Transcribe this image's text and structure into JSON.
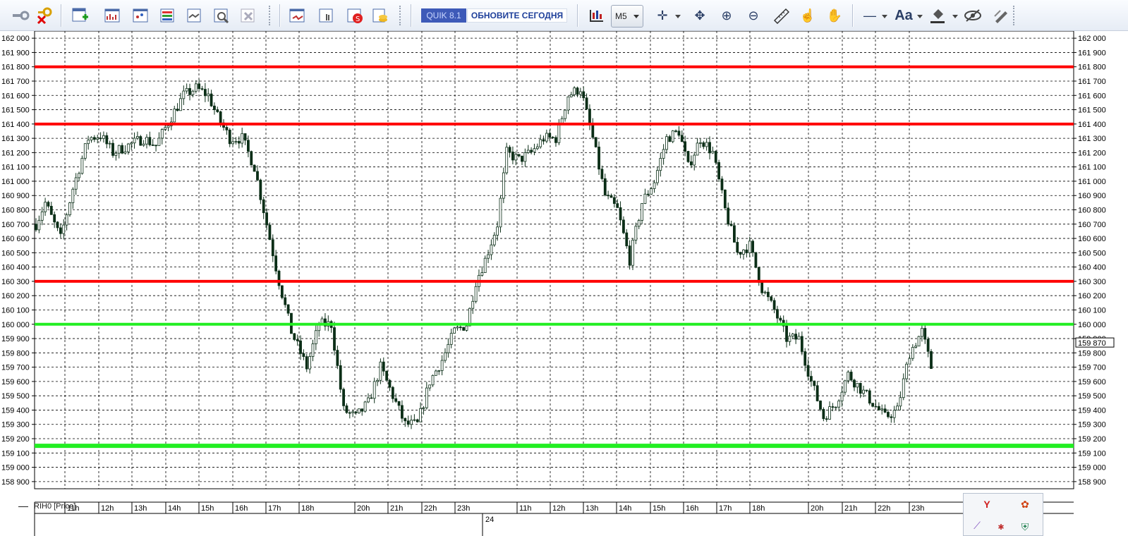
{
  "toolbar": {
    "quik_version": "QUIK 8.1",
    "update_label": "ОБНОВИТЕ СЕГОДНЯ",
    "timeframe": "M5",
    "font_button": "Aa"
  },
  "chart": {
    "instrument_label": "RIH0 [Price]",
    "last_price": "159 870",
    "price_ticks": [
      "162 000",
      "161 900",
      "161 800",
      "161 700",
      "161 600",
      "161 500",
      "161 400",
      "161 300",
      "161 200",
      "161 100",
      "161 000",
      "160 900",
      "160 800",
      "160 700",
      "160 600",
      "160 500",
      "160 400",
      "160 300",
      "160 200",
      "160 100",
      "160 000",
      "159 900",
      "159 800",
      "159 700",
      "159 600",
      "159 500",
      "159 400",
      "159 300",
      "159 200",
      "159 100",
      "159 000",
      "158 900"
    ],
    "time_ticks": [
      "11h",
      "12h",
      "13h",
      "14h",
      "15h",
      "16h",
      "17h",
      "18h",
      "20h",
      "21h",
      "22h",
      "23h",
      "11h",
      "12h",
      "13h",
      "14h",
      "15h",
      "16h",
      "17h",
      "18h",
      "20h",
      "21h",
      "22h",
      "23h"
    ],
    "date_label": "24",
    "colors": {
      "resistance": "#ff0000",
      "support": "#22ee22",
      "candle": "#0b2e17",
      "grid": "#000000"
    }
  },
  "chart_data": {
    "type": "candlestick",
    "instrument": "RIH0",
    "timeframe": "M5",
    "ylim": [
      158850,
      162050
    ],
    "grid": true,
    "horizontal_levels": [
      {
        "price": 161800,
        "color": "red"
      },
      {
        "price": 161400,
        "color": "red"
      },
      {
        "price": 160300,
        "color": "red"
      },
      {
        "price": 160000,
        "color": "green"
      },
      {
        "price": 159150,
        "color": "green"
      }
    ],
    "close_path": [
      [
        0,
        160700
      ],
      [
        3,
        160850
      ],
      [
        8,
        160600
      ],
      [
        12,
        160950
      ],
      [
        17,
        161300
      ],
      [
        21,
        161320
      ],
      [
        25,
        161200
      ],
      [
        30,
        161250
      ],
      [
        35,
        161300
      ],
      [
        39,
        161250
      ],
      [
        44,
        161450
      ],
      [
        48,
        161600
      ],
      [
        52,
        161650
      ],
      [
        56,
        161600
      ],
      [
        59,
        161450
      ],
      [
        63,
        161300
      ],
      [
        67,
        161300
      ],
      [
        71,
        161100
      ],
      [
        75,
        160700
      ],
      [
        79,
        160300
      ],
      [
        83,
        159950
      ],
      [
        88,
        159700
      ],
      [
        92,
        160000
      ],
      [
        96,
        160000
      ],
      [
        100,
        159400
      ],
      [
        104,
        159350
      ],
      [
        108,
        159450
      ],
      [
        112,
        159700
      ],
      [
        116,
        159500
      ],
      [
        120,
        159300
      ],
      [
        124,
        159300
      ],
      [
        128,
        159600
      ],
      [
        132,
        159750
      ],
      [
        136,
        159950
      ],
      [
        140,
        160000
      ],
      [
        143,
        160300
      ],
      [
        146,
        160450
      ],
      [
        150,
        160700
      ],
      [
        153,
        161200
      ],
      [
        157,
        161150
      ],
      [
        161,
        161200
      ],
      [
        165,
        161300
      ],
      [
        169,
        161300
      ],
      [
        173,
        161600
      ],
      [
        177,
        161650
      ],
      [
        181,
        161300
      ],
      [
        185,
        160900
      ],
      [
        189,
        160800
      ],
      [
        193,
        160450
      ],
      [
        197,
        160850
      ],
      [
        201,
        161000
      ],
      [
        205,
        161300
      ],
      [
        209,
        161350
      ],
      [
        212,
        161100
      ],
      [
        216,
        161300
      ],
      [
        220,
        161200
      ],
      [
        224,
        160800
      ],
      [
        228,
        160500
      ],
      [
        232,
        160550
      ],
      [
        236,
        160250
      ],
      [
        240,
        160100
      ],
      [
        244,
        159900
      ],
      [
        248,
        159900
      ],
      [
        252,
        159600
      ],
      [
        256,
        159350
      ],
      [
        260,
        159450
      ],
      [
        264,
        159650
      ],
      [
        268,
        159550
      ],
      [
        272,
        159450
      ],
      [
        276,
        159350
      ],
      [
        280,
        159400
      ],
      [
        284,
        159800
      ],
      [
        288,
        159950
      ],
      [
        291,
        159700
      ]
    ]
  }
}
